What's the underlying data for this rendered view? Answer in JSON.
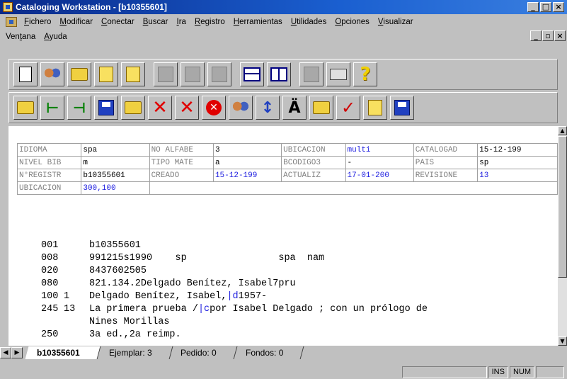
{
  "window": {
    "title": "Cataloging Workstation - [b10355601]"
  },
  "menu": {
    "row1": [
      "Fichero",
      "Modificar",
      "Conectar",
      "Buscar",
      "Ira",
      "Registro",
      "Herramientas",
      "Utilidades",
      "Opciones",
      "Visualizar"
    ],
    "row2": [
      "Ventana",
      "Ayuda"
    ]
  },
  "toolbar1": {
    "buttons": [
      {
        "icon": "new-document-icon"
      },
      {
        "icon": "users-icon"
      },
      {
        "icon": "open-folder-icon"
      },
      {
        "icon": "open-file-icon"
      },
      {
        "icon": "zip-icon"
      },
      {
        "icon": "cut-icon"
      },
      {
        "icon": "copy-icon"
      },
      {
        "icon": "paste-icon"
      },
      {
        "icon": "tile-horizontal-icon"
      },
      {
        "icon": "tile-vertical-icon"
      },
      {
        "icon": "disabled-icon"
      },
      {
        "icon": "print-icon"
      },
      {
        "icon": "help-icon"
      }
    ]
  },
  "toolbar2": {
    "buttons": [
      {
        "icon": "folder-back-icon"
      },
      {
        "icon": "insert-field-icon"
      },
      {
        "icon": "split-icon"
      },
      {
        "icon": "save-icon"
      },
      {
        "icon": "folder-open-icon"
      },
      {
        "icon": "delete-icon"
      },
      {
        "icon": "delete-all-icon"
      },
      {
        "icon": "stop-icon"
      },
      {
        "icon": "validate-icon"
      },
      {
        "icon": "case-icon"
      },
      {
        "icon": "diacritic-icon",
        "label": "Ä"
      },
      {
        "icon": "folder-export-icon"
      },
      {
        "icon": "check-icon"
      },
      {
        "icon": "import-icon"
      },
      {
        "icon": "save-date-icon"
      }
    ]
  },
  "fixed_fields": [
    [
      {
        "label": "IDIOMA",
        "value": "spa"
      },
      {
        "label": "NO ALFABE",
        "value": "3"
      },
      {
        "label": "UBICACION",
        "value": "multi",
        "blue": true
      },
      {
        "label": "CATALOGAD",
        "value": "15-12-199"
      }
    ],
    [
      {
        "label": "NIVEL BIB",
        "value": "m"
      },
      {
        "label": "TIPO MATE",
        "value": "a"
      },
      {
        "label": "BCODIGO3",
        "value": "-"
      },
      {
        "label": "PAIS",
        "value": "sp"
      }
    ],
    [
      {
        "label": "N°REGISTR",
        "value": "b10355601"
      },
      {
        "label": "CREADO",
        "value": "15-12-199",
        "blue": true
      },
      {
        "label": "ACTUALIZ",
        "value": "17-01-200",
        "blue": true
      },
      {
        "label": "REVISIONE",
        "value": "13",
        "blue": true
      }
    ],
    [
      {
        "label": "UBICACION",
        "value": "300,100",
        "blue": true
      }
    ]
  ],
  "marc_fields": [
    {
      "tag": "001",
      "ind": "",
      "text": "b10355601"
    },
    {
      "tag": "008",
      "ind": "",
      "text": "991215s1990    sp                spa  nam"
    },
    {
      "tag": "020",
      "ind": "",
      "text": "8437602505"
    },
    {
      "tag": "080",
      "ind": "",
      "text": "821.134.2Delgado Benítez, Isabel7pru"
    },
    {
      "tag": "100",
      "ind": "1",
      "text": "Delgado Benítez, Isabel,",
      "sf": "|d",
      "rest": "1957-"
    },
    {
      "tag": "245",
      "ind": "13",
      "text": "La primera prueba /",
      "sf": "|c",
      "rest": "por Isabel Delgado ; con un prólogo de"
    },
    {
      "tag": "",
      "ind": "",
      "text": "Nines Morillas"
    },
    {
      "tag": "250",
      "ind": "",
      "text": "3a ed.,2a reimp."
    }
  ],
  "tabs": [
    {
      "label": "b10355601",
      "active": true
    },
    {
      "label": "Ejemplar: 3",
      "active": false
    },
    {
      "label": "Pedido: 0",
      "active": false
    },
    {
      "label": "Fondos: 0",
      "active": false
    }
  ],
  "status": {
    "ins": "INS",
    "num": "NUM"
  }
}
